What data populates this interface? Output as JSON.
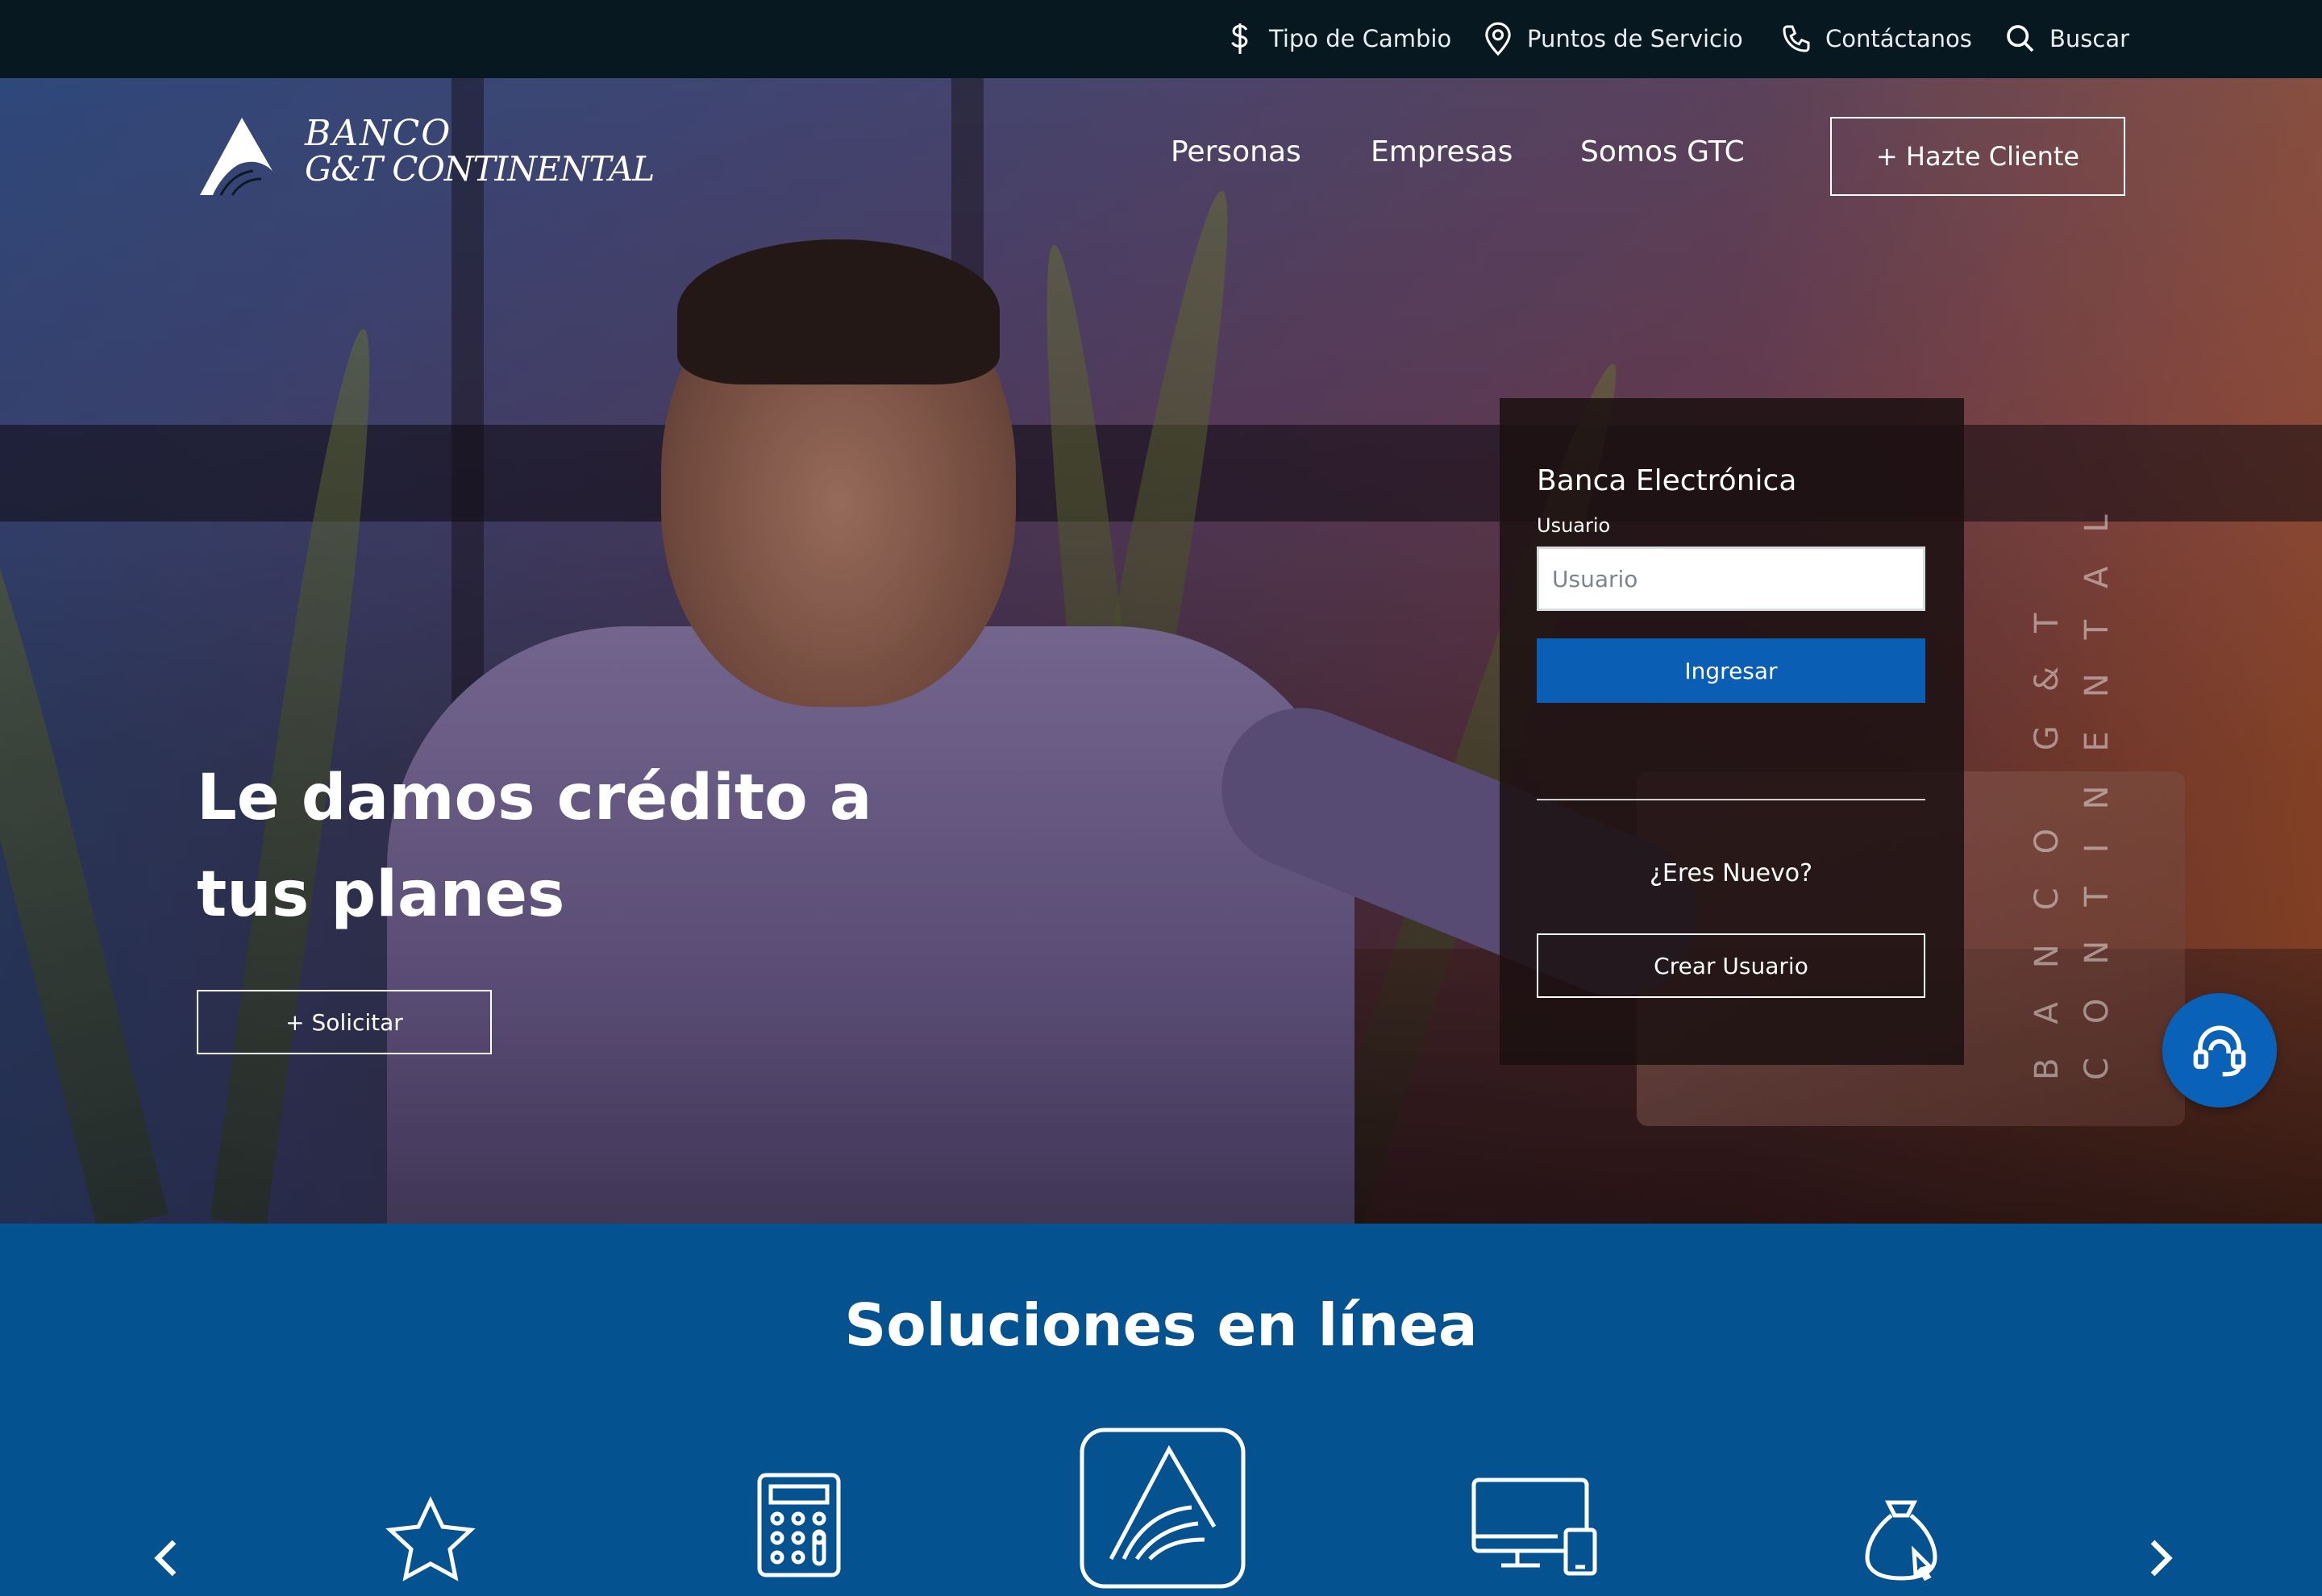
{
  "topbar": {
    "exchange": "Tipo de Cambio",
    "locations": "Puntos de Servicio",
    "contact": "Contáctanos",
    "search": "Buscar"
  },
  "brand": {
    "line1": "BANCO",
    "line2": "G&T CONTINENTAL"
  },
  "nav": {
    "personas": "Personas",
    "empresas": "Empresas",
    "somos": "Somos GTC",
    "hazte": "+ Hazte Cliente"
  },
  "hero": {
    "headline_line1": "Le damos crédito a",
    "headline_line2": "tus planes",
    "cta": "+ Solicitar"
  },
  "login": {
    "title": "Banca Electrónica",
    "user_label": "Usuario",
    "user_placeholder": "Usuario",
    "submit": "Ingresar",
    "new_prompt": "¿Eres Nuevo?",
    "create": "Crear Usuario"
  },
  "watermark": {
    "col1": "BANCO G&T",
    "col2": "CONTINENTAL"
  },
  "solutions": {
    "title": "Soluciones en línea",
    "icons": [
      "star-icon",
      "calculator-icon",
      "gtc-app-icon",
      "devices-icon",
      "money-bag-icon"
    ]
  },
  "colors": {
    "topbar": "#071820",
    "primary_blue": "#0a5fb4",
    "solutions_bg": "#04528f"
  }
}
